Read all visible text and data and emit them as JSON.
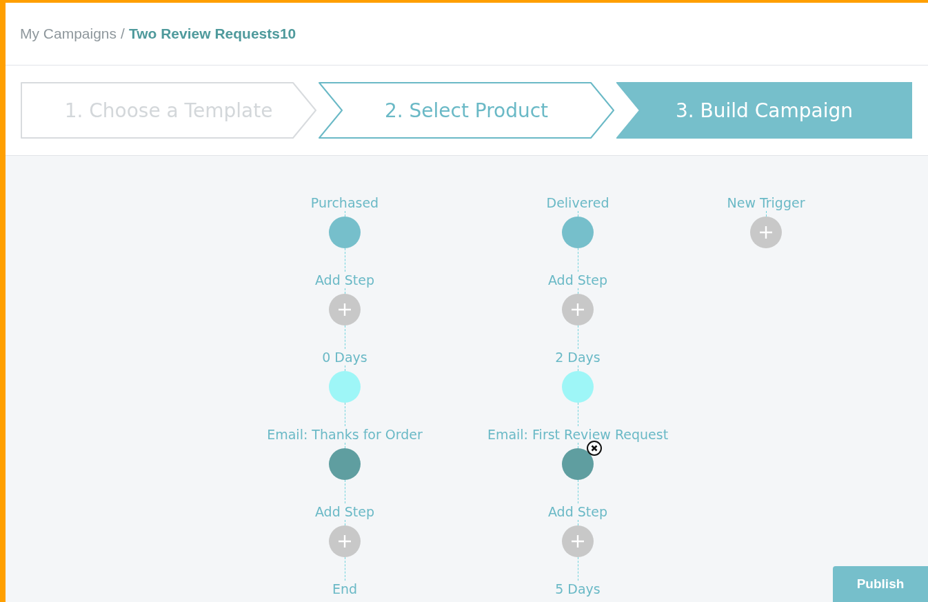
{
  "breadcrumb": {
    "parent": "My Campaigns",
    "separator": "/",
    "current": "Two Review Requests10"
  },
  "steps": [
    {
      "label": "1. Choose a Template",
      "selected": false,
      "disabled": true
    },
    {
      "label": "2. Select Product",
      "selected": false,
      "disabled": false
    },
    {
      "label": "3. Build Campaign",
      "selected": true,
      "disabled": false
    }
  ],
  "flows": [
    {
      "nodes": [
        {
          "label": "Purchased",
          "kind": "trigger",
          "removable": false
        },
        {
          "label": "Add Step",
          "kind": "add",
          "removable": false
        },
        {
          "label": "0 Days",
          "kind": "delay",
          "removable": false
        },
        {
          "label": "Email: Thanks for Order",
          "kind": "email",
          "removable": false
        },
        {
          "label": "Add Step",
          "kind": "add",
          "removable": false
        },
        {
          "label": "End",
          "kind": "end",
          "removable": false
        }
      ]
    },
    {
      "nodes": [
        {
          "label": "Delivered",
          "kind": "trigger",
          "removable": false
        },
        {
          "label": "Add Step",
          "kind": "add",
          "removable": false
        },
        {
          "label": "2 Days",
          "kind": "delay",
          "removable": false
        },
        {
          "label": "Email: First Review Request",
          "kind": "email",
          "removable": true
        },
        {
          "label": "Add Step",
          "kind": "add",
          "removable": false
        },
        {
          "label": "5 Days",
          "kind": "delay-label",
          "removable": false
        }
      ]
    },
    {
      "nodes": [
        {
          "label": "New Trigger",
          "kind": "add",
          "removable": false
        }
      ]
    }
  ],
  "publish_button": "Publish"
}
